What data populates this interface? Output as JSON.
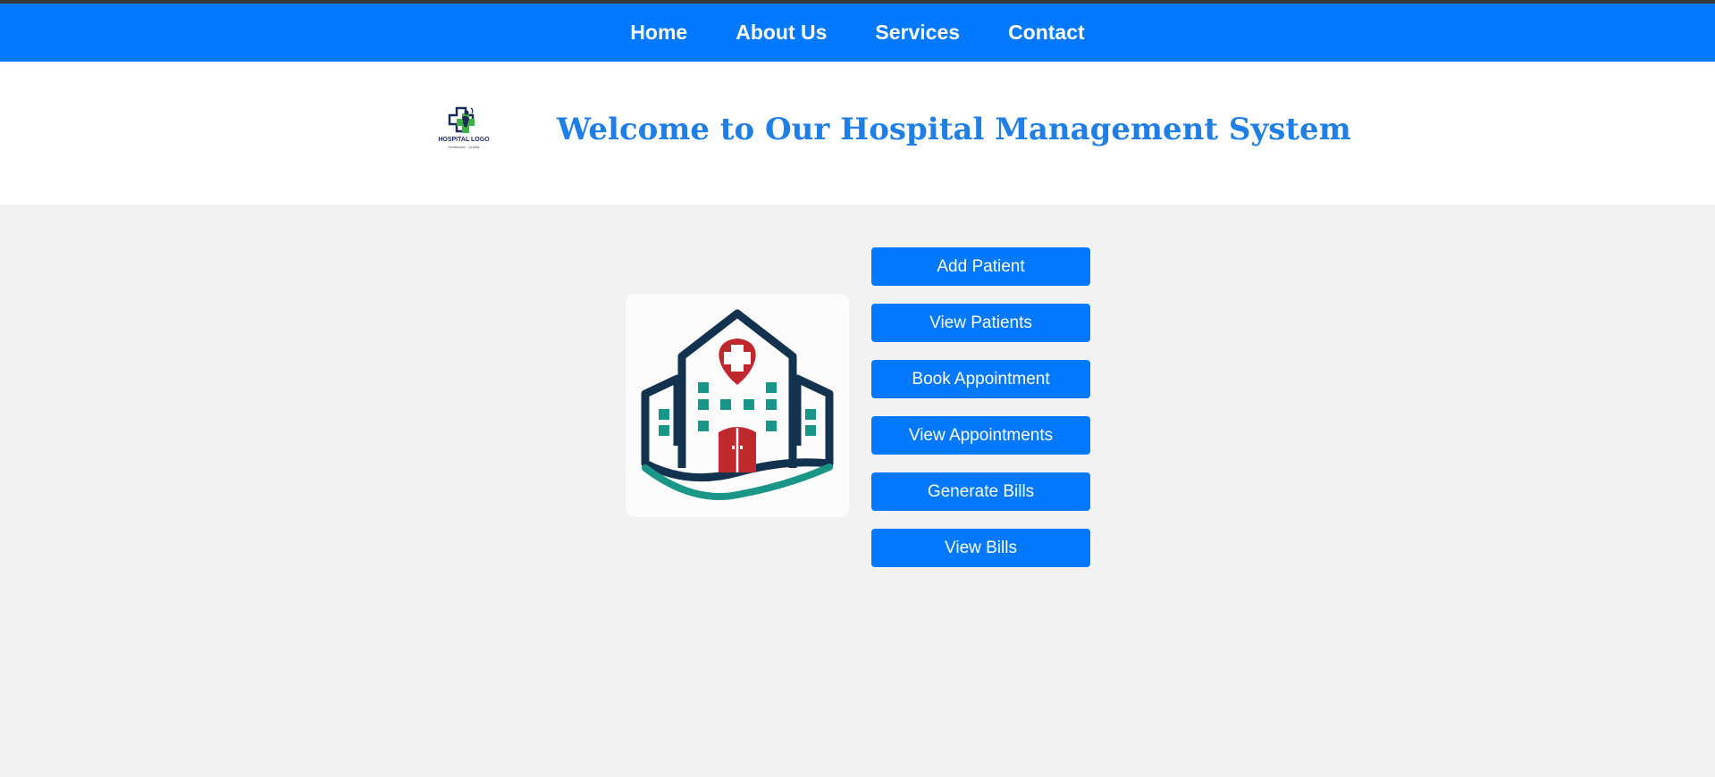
{
  "nav": {
    "items": [
      {
        "label": "Home"
      },
      {
        "label": "About Us"
      },
      {
        "label": "Services"
      },
      {
        "label": "Contact"
      }
    ]
  },
  "header": {
    "logo_text": "HOSPITAL LOGO",
    "logo_subtext": "Healthcare · Quality",
    "title": "Welcome to Our Hospital Management System"
  },
  "actions": [
    {
      "label": "Add Patient"
    },
    {
      "label": "View Patients"
    },
    {
      "label": "Book Appointment"
    },
    {
      "label": "View Appointments"
    },
    {
      "label": "Generate Bills"
    },
    {
      "label": "View Bills"
    }
  ],
  "colors": {
    "primary": "#0078ff",
    "title": "#1f7fe6",
    "background": "#f2f2f2",
    "building_navy": "#12324f",
    "building_teal": "#1a9688",
    "building_red": "#c0282d"
  },
  "icons": {
    "logo": "hospital-cross-logo-icon",
    "building": "hospital-building-icon"
  }
}
